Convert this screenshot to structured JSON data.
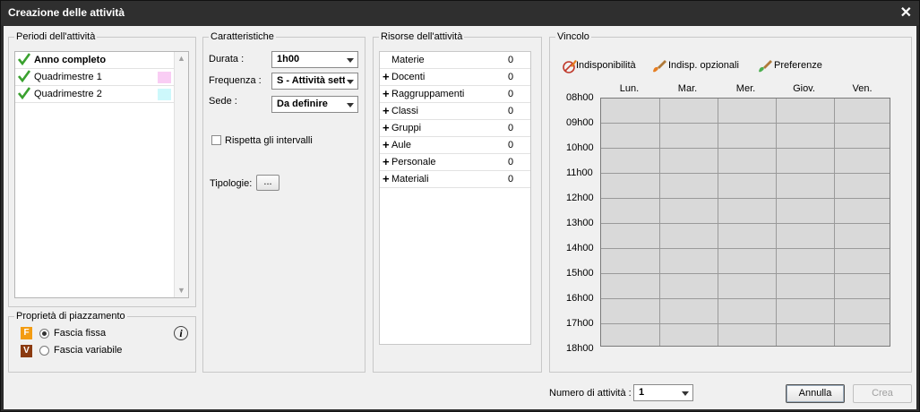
{
  "window": {
    "title": "Creazione delle attività"
  },
  "periodi": {
    "legend": "Periodi dell'attività",
    "items": [
      {
        "label": "Anno completo",
        "bold": true,
        "swatch": ""
      },
      {
        "label": "Quadrimestre 1",
        "bold": false,
        "swatch": "#f9cdf4"
      },
      {
        "label": "Quadrimestre 2",
        "bold": false,
        "swatch": "#cdf8fb"
      }
    ]
  },
  "proprieta": {
    "legend": "Proprietà di piazzamento",
    "fissa": {
      "badge": "F",
      "label": "Fascia fissa",
      "color": "#f39c12"
    },
    "variabile": {
      "badge": "V",
      "label": "Fascia variabile",
      "color": "#8b3a10"
    },
    "info_icon": "i"
  },
  "caratteristiche": {
    "legend": "Caratteristiche",
    "durata": {
      "label": "Durata :",
      "value": "1h00"
    },
    "frequenza": {
      "label": "Frequenza :",
      "value": "S - Attività settimanale"
    },
    "sede": {
      "label": "Sede :",
      "value": "Da definire"
    },
    "rispetta": "Rispetta gli intervalli",
    "tipologie": {
      "label": "Tipologie:",
      "button": "..."
    }
  },
  "risorse": {
    "legend": "Risorse dell'attività",
    "rows": [
      {
        "plus": "",
        "name": "Materie",
        "count": "0"
      },
      {
        "plus": "+",
        "name": "Docenti",
        "count": "0"
      },
      {
        "plus": "+",
        "name": "Raggruppamenti",
        "count": "0"
      },
      {
        "plus": "+",
        "name": "Classi",
        "count": "0"
      },
      {
        "plus": "+",
        "name": "Gruppi",
        "count": "0"
      },
      {
        "plus": "+",
        "name": "Aule",
        "count": "0"
      },
      {
        "plus": "+",
        "name": "Personale",
        "count": "0"
      },
      {
        "plus": "+",
        "name": "Materiali",
        "count": "0"
      }
    ]
  },
  "vincolo": {
    "legend": "Vincolo",
    "tools": [
      {
        "label": "Indisponibilità",
        "icon": "eraser-brush-icon"
      },
      {
        "label": "Indisp. opzionali",
        "icon": "orange-brush-icon"
      },
      {
        "label": "Preferenze",
        "icon": "green-brush-icon"
      }
    ],
    "days": [
      "Lun.",
      "Mar.",
      "Mer.",
      "Giov.",
      "Ven."
    ],
    "hours": [
      "08h00",
      "09h00",
      "10h00",
      "11h00",
      "12h00",
      "13h00",
      "14h00",
      "15h00",
      "16h00",
      "17h00",
      "18h00"
    ]
  },
  "footer": {
    "numero_label": "Numero di attività :",
    "numero_value": "1",
    "annulla": "Annulla",
    "crea": "Crea"
  }
}
